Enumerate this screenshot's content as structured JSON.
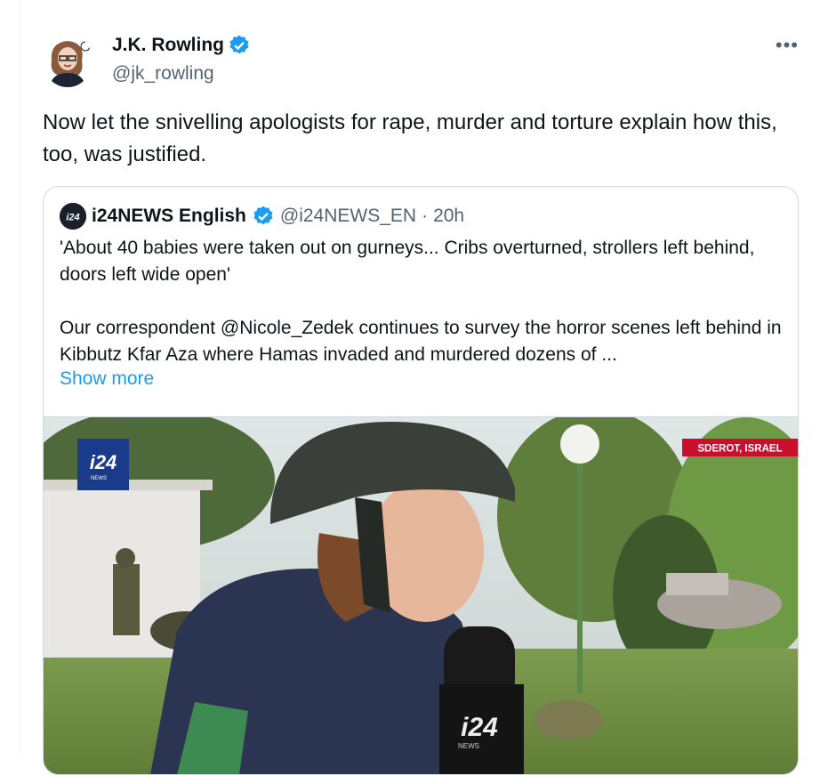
{
  "author": {
    "name": "J.K. Rowling",
    "handle": "@jk_rowling",
    "verified": true
  },
  "more_icon": "more-horizontal-icon",
  "tweet": {
    "text": "Now let the snivelling apologists for rape, murder and torture explain how this, too, was justified."
  },
  "quote": {
    "name": "i24NEWS English",
    "handle": "@i24NEWS_EN",
    "separator": "·",
    "time": "20h",
    "logo_text": "i24",
    "paragraph1": "'About 40 babies were taken out on gurneys... Cribs overturned, strollers left behind, doors left wide open'",
    "paragraph2": "Our correspondent @Nicole_Zedek continues to survey the horror scenes left behind in Kibbutz Kfar Aza where Hamas invaded and murdered dozens of ...",
    "show_more": "Show more"
  },
  "video": {
    "channel_logo": "i24",
    "channel_logo_sub": "NEWS",
    "location_badge": "SDEROT, ISRAEL",
    "mic_logo": "i24",
    "mic_logo_sub": "NEWS"
  },
  "colors": {
    "verified": "#1d9bf0",
    "link": "#1d9bf0",
    "location_badge": "#c8102e",
    "logo_bg": "#1a3a8a"
  }
}
